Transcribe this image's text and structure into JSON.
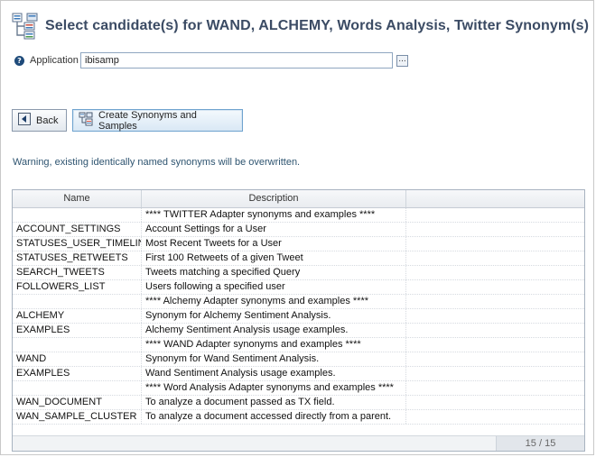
{
  "header": {
    "title": "Select candidate(s) for WAND, ALCHEMY, Words Analysis, Twitter Synonym(s)"
  },
  "application": {
    "label": "Application",
    "value": "ibisamp",
    "browse_label": "..."
  },
  "buttons": {
    "back": "Back",
    "create": "Create Synonyms and Samples"
  },
  "warning": "Warning, existing identically named synonyms will be overwritten.",
  "grid": {
    "columns": [
      "Name",
      "Description"
    ],
    "rows": [
      {
        "name": "",
        "description": "**** TWITTER Adapter synonyms and examples ****",
        "section": true
      },
      {
        "name": "ACCOUNT_SETTINGS",
        "description": "Account Settings for a User"
      },
      {
        "name": "STATUSES_USER_TIMELINE",
        "description": "Most Recent Tweets for a User"
      },
      {
        "name": "STATUSES_RETWEETS",
        "description": "First 100 Retweets of a given Tweet"
      },
      {
        "name": "SEARCH_TWEETS",
        "description": "Tweets matching a specified Query"
      },
      {
        "name": "FOLLOWERS_LIST",
        "description": "Users following a specified user"
      },
      {
        "name": "",
        "description": "**** Alchemy Adapter synonyms and examples ****",
        "section": true
      },
      {
        "name": "ALCHEMY",
        "description": "Synonym for Alchemy Sentiment Analysis."
      },
      {
        "name": "EXAMPLES",
        "description": "Alchemy Sentiment Analysis usage examples."
      },
      {
        "name": "",
        "description": "**** WAND Adapter synonyms and examples ****",
        "section": true
      },
      {
        "name": "WAND",
        "description": "Synonym for Wand Sentiment Analysis."
      },
      {
        "name": "EXAMPLES",
        "description": "Wand Sentiment Analysis usage examples."
      },
      {
        "name": "",
        "description": "**** Word Analysis Adapter synonyms and examples ****",
        "section": true
      },
      {
        "name": "WAN_DOCUMENT",
        "description": "To analyze a document passed as TX field."
      },
      {
        "name": "WAN_SAMPLE_CLUSTER",
        "description": "To analyze a document accessed directly from a parent."
      }
    ],
    "pager": "15 / 15"
  },
  "colors": {
    "title": "#3b4b64",
    "warning": "#2e5470",
    "accent": "#6fa3cf"
  },
  "icons": {
    "logo": "synonym-tree-icon",
    "help": "help-icon",
    "back": "back-arrow-icon",
    "create": "create-synonyms-icon"
  }
}
